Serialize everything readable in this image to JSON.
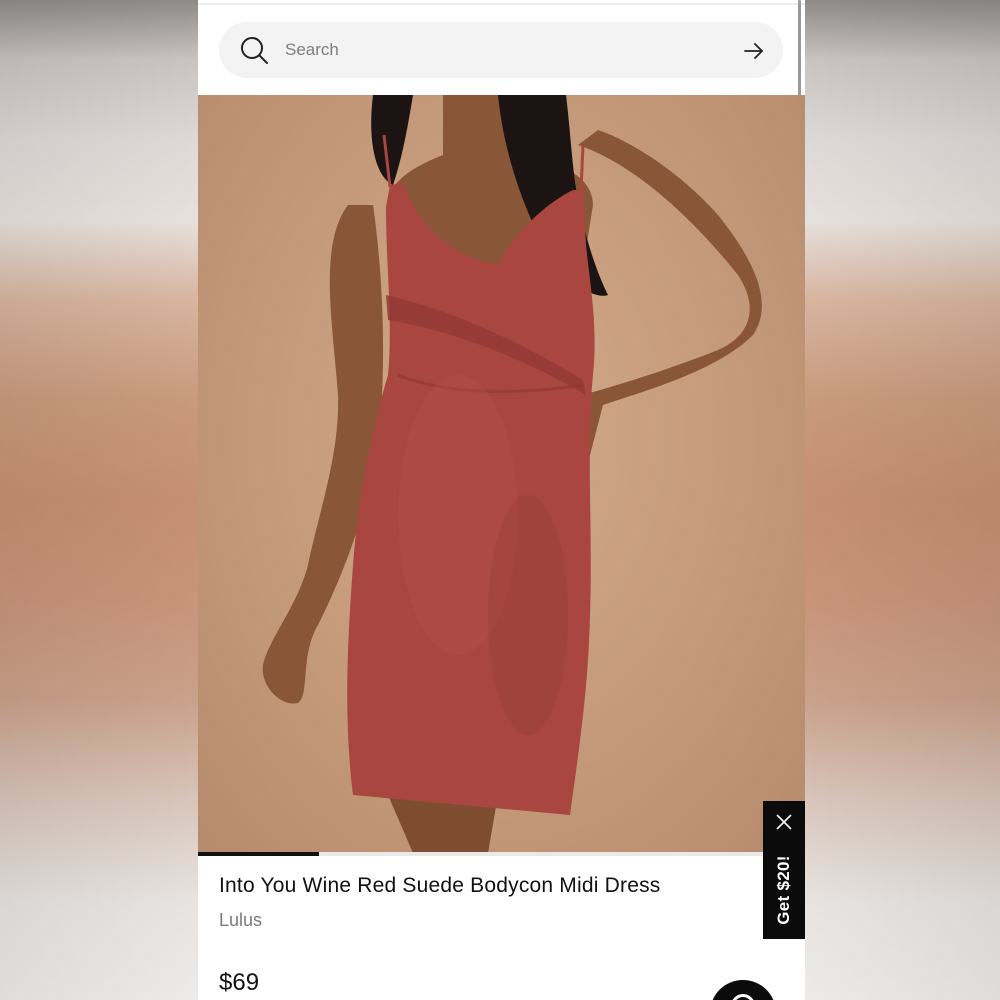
{
  "search": {
    "placeholder": "Search",
    "icon": "search-icon",
    "submit_icon": "arrow-right-icon"
  },
  "gallery": {
    "image_alt": "Model wearing a wine red suede bodycon midi dress",
    "progress": 0.2
  },
  "product": {
    "title": "Into You Wine Red Suede Bodycon Midi Dress",
    "brand": "Lulus",
    "price": "$69"
  },
  "promo": {
    "label": "Get $20!",
    "close_icon": "close-icon"
  },
  "chat": {
    "icon": "chat-icon"
  },
  "colors": {
    "dress": "#a8463f",
    "background": "#c49a7b",
    "skin": "#8a5638",
    "hair": "#1b1412",
    "accent": "#0b0b0b"
  }
}
